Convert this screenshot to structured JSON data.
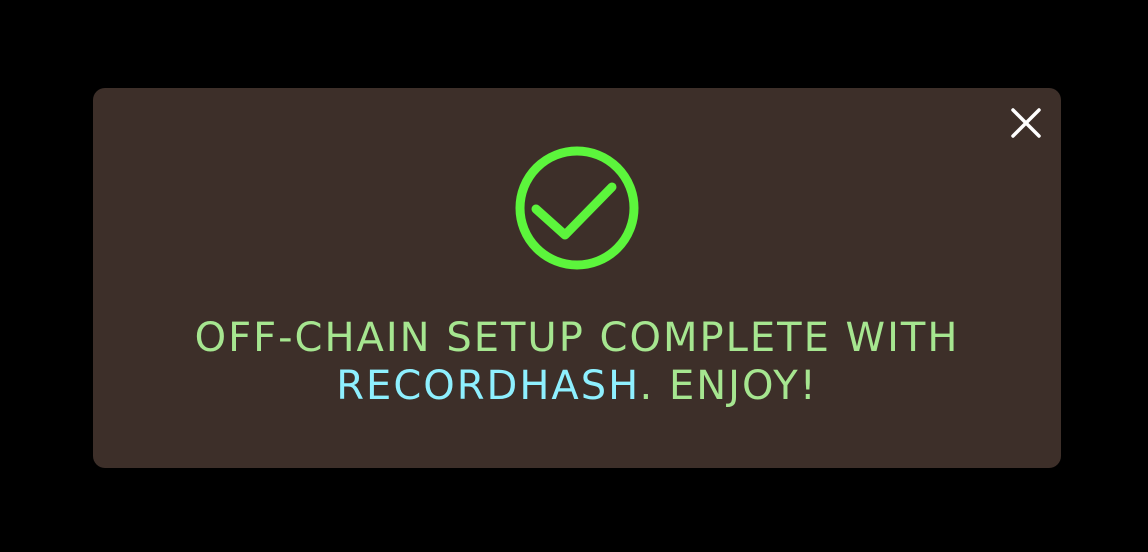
{
  "dialog": {
    "close_label": "×",
    "message_line1": "OFF-CHAIN SETUP COMPLETE WITH",
    "brand": "RECORDHASH",
    "message_tail": ". ENJOY!"
  },
  "icons": {
    "status": "check-circle-icon",
    "close": "close-icon"
  },
  "colors": {
    "background": "#000000",
    "dialog": "#3d2f29",
    "success": "#5cf53c",
    "text": "#a6e690",
    "brand": "#8ef0ff",
    "close": "#ffffff"
  }
}
